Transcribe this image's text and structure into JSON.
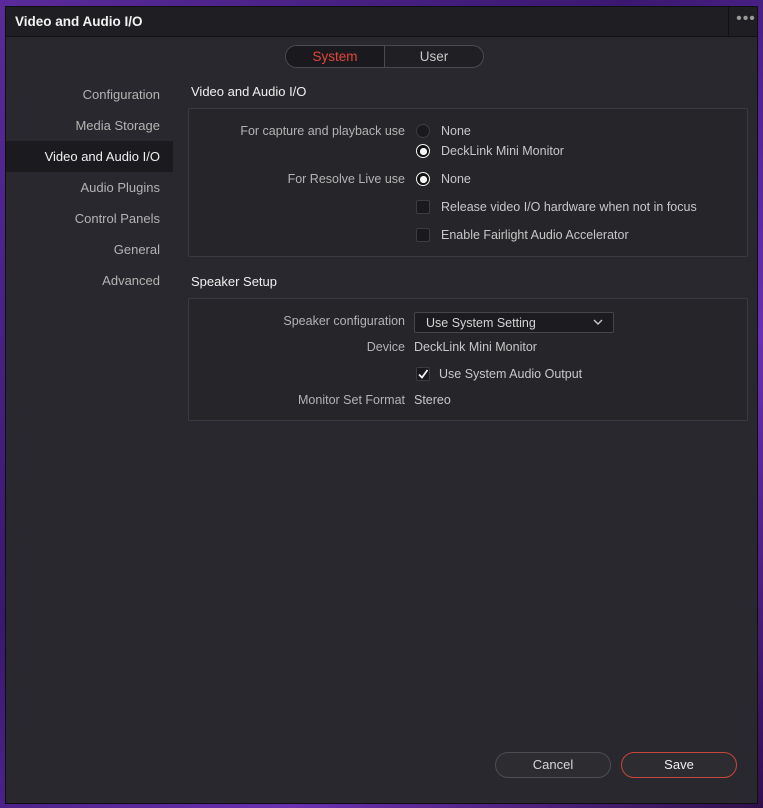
{
  "window": {
    "title": "Video and Audio I/O"
  },
  "segmented": {
    "system_label": "System",
    "user_label": "User",
    "active": "System",
    "active_color": "#e2473c"
  },
  "sidebar": {
    "items": [
      {
        "label": "Configuration"
      },
      {
        "label": "Media Storage"
      },
      {
        "label": "Video and Audio I/O",
        "active": true
      },
      {
        "label": "Audio Plugins"
      },
      {
        "label": "Control Panels"
      },
      {
        "label": "General"
      },
      {
        "label": "Advanced"
      }
    ]
  },
  "video_audio": {
    "section_title": "Video and Audio I/O",
    "capture_label": "For capture and playback use",
    "capture_options": [
      {
        "label": "None",
        "selected": false
      },
      {
        "label": "DeckLink Mini Monitor",
        "selected": true
      }
    ],
    "resolve_live_label": "For Resolve Live use",
    "resolve_live_option": {
      "label": "None",
      "selected": true
    },
    "release_hw_label": "Release video I/O hardware when not in focus",
    "release_hw_checked": false,
    "fairlight_label": "Enable Fairlight Audio Accelerator",
    "fairlight_checked": false
  },
  "speaker": {
    "section_title": "Speaker Setup",
    "config_label": "Speaker configuration",
    "config_value": "Use System Setting",
    "device_label": "Device",
    "device_value": "DeckLink Mini Monitor",
    "system_audio_label": "Use System Audio Output",
    "system_audio_checked": true,
    "monitor_format_label": "Monitor Set Format",
    "monitor_format_value": "Stereo"
  },
  "footer": {
    "cancel_label": "Cancel",
    "save_label": "Save",
    "save_border_color": "#c8453a"
  }
}
